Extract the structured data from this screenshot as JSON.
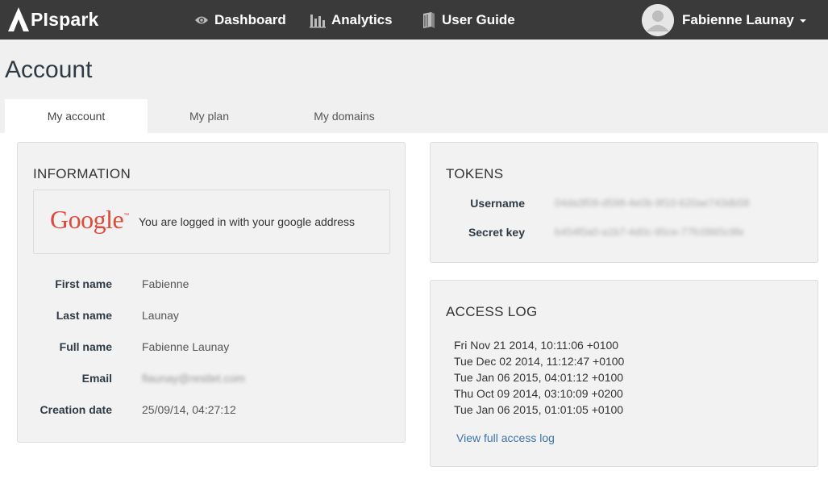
{
  "brand": {
    "name": "PIspark",
    "logo_letter": "A"
  },
  "nav": {
    "items": [
      {
        "label": "Dashboard",
        "icon": "eye-icon"
      },
      {
        "label": "Analytics",
        "icon": "bar-chart-icon"
      },
      {
        "label": "User Guide",
        "icon": "book-icon"
      }
    ]
  },
  "user": {
    "name": "Fabienne Launay",
    "avatar_icon": "user-avatar-icon"
  },
  "page": {
    "title": "Account"
  },
  "tabs": [
    {
      "label": "My account",
      "active": true
    },
    {
      "label": "My plan",
      "active": false
    },
    {
      "label": "My domains",
      "active": false
    }
  ],
  "information": {
    "title": "INFORMATION",
    "google": {
      "logo_text": "Google",
      "logo_tm": "™",
      "message": "You are logged in with your google address"
    },
    "fields": [
      {
        "label": "First name",
        "value": "Fabienne"
      },
      {
        "label": "Last name",
        "value": "Launay"
      },
      {
        "label": "Full name",
        "value": "Fabienne Launay"
      },
      {
        "label": "Email",
        "value": "flaunay@restlet.com"
      },
      {
        "label": "Creation date",
        "value": "25/09/14, 04:27:12"
      }
    ]
  },
  "tokens": {
    "title": "TOKENS",
    "rows": [
      {
        "label": "Username",
        "value": "04da3f09-d598-4e0b-9f10-620ae743db58"
      },
      {
        "label": "Secret key",
        "value": "b454f0a0-a1b7-4d0c-95ce-77fc0865c9fe"
      }
    ]
  },
  "access_log": {
    "title": "ACCESS LOG",
    "entries": [
      "Fri Nov 21 2014, 10:11:06 +0100",
      "Tue Dec 02 2014, 11:12:47 +0100",
      "Tue Jan 06 2015, 04:01:12 +0100",
      "Thu Oct 09 2014, 03:10:09 +0200",
      "Tue Jan 06 2015, 01:01:05 +0100"
    ],
    "link_label": "View full access log"
  },
  "colors": {
    "navbar": "#3a3a3a",
    "link": "#3b73af",
    "google_red": "#dd4b39",
    "label": "#2e3a46"
  }
}
